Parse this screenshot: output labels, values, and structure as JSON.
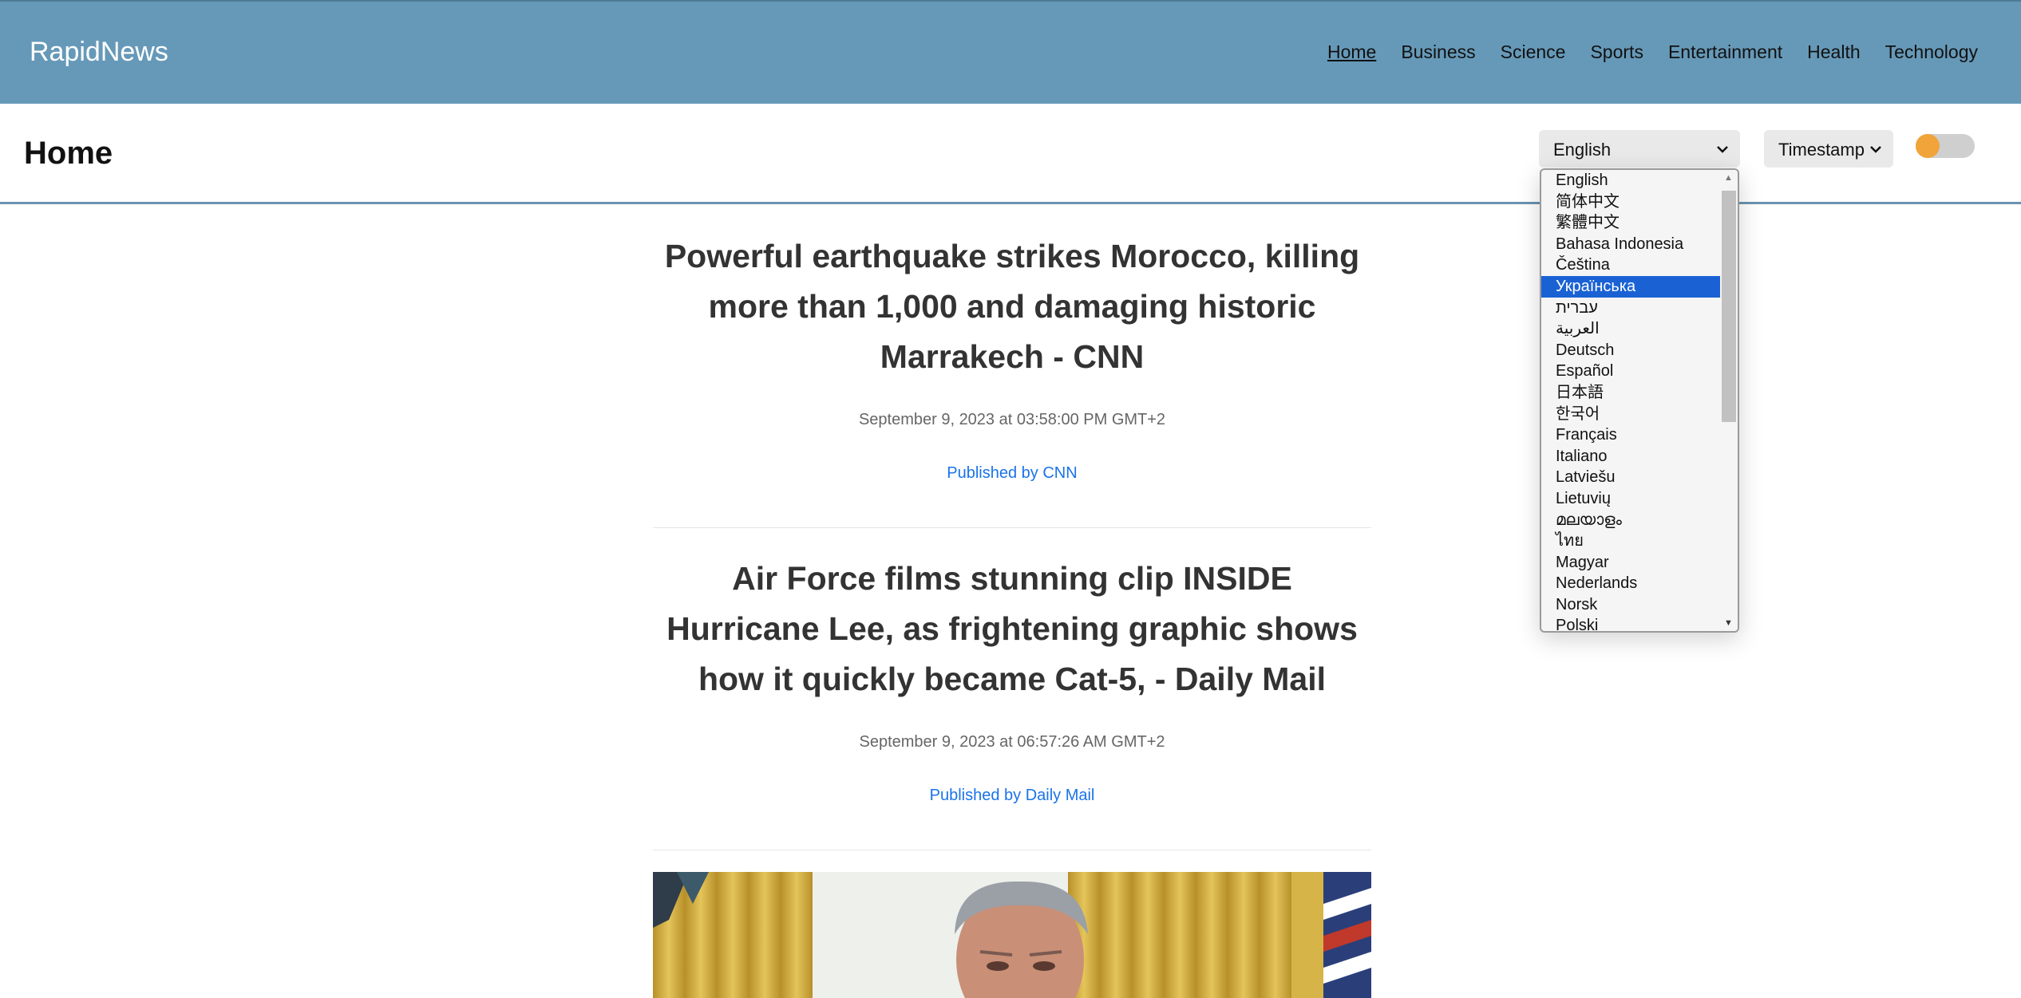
{
  "header": {
    "brand": "RapidNews",
    "nav": [
      "Home",
      "Business",
      "Science",
      "Sports",
      "Entertainment",
      "Health",
      "Technology"
    ],
    "active_nav": "Home"
  },
  "subheader": {
    "title": "Home",
    "language_select": {
      "value": "English"
    },
    "sort_select": {
      "value": "Timestamp"
    },
    "theme_toggle": {
      "state": "off",
      "knob_color": "#f0a43a"
    }
  },
  "language_dropdown": {
    "options": [
      "English",
      "简体中文",
      "繁體中文",
      "Bahasa Indonesia",
      "Čeština",
      "Українська",
      "עברית",
      "العربية",
      "Deutsch",
      "Español",
      "日本語",
      "한국어",
      "Français",
      "Italiano",
      "Latviešu",
      "Lietuvių",
      "മലയാളം",
      "ไทย",
      "Magyar",
      "Nederlands",
      "Norsk",
      "Polski"
    ],
    "highlighted": "Українська"
  },
  "articles": [
    {
      "title": "Powerful earthquake strikes Morocco, killing more than 1,000 and damaging historic Marrakech - CNN",
      "timestamp": "September 9, 2023 at 03:58:00 PM GMT+2",
      "source": "Published by CNN"
    },
    {
      "title": "Air Force films stunning clip INSIDE Hurricane Lee, as frightening graphic shows how it quickly became Cat-5, - Daily Mail",
      "timestamp": "September 9, 2023 at 06:57:26 AM GMT+2",
      "source": "Published by Daily Mail"
    }
  ],
  "colors": {
    "header_bg": "#6699b8",
    "link": "#1a73e8",
    "selected_option": "#1a62d4"
  }
}
